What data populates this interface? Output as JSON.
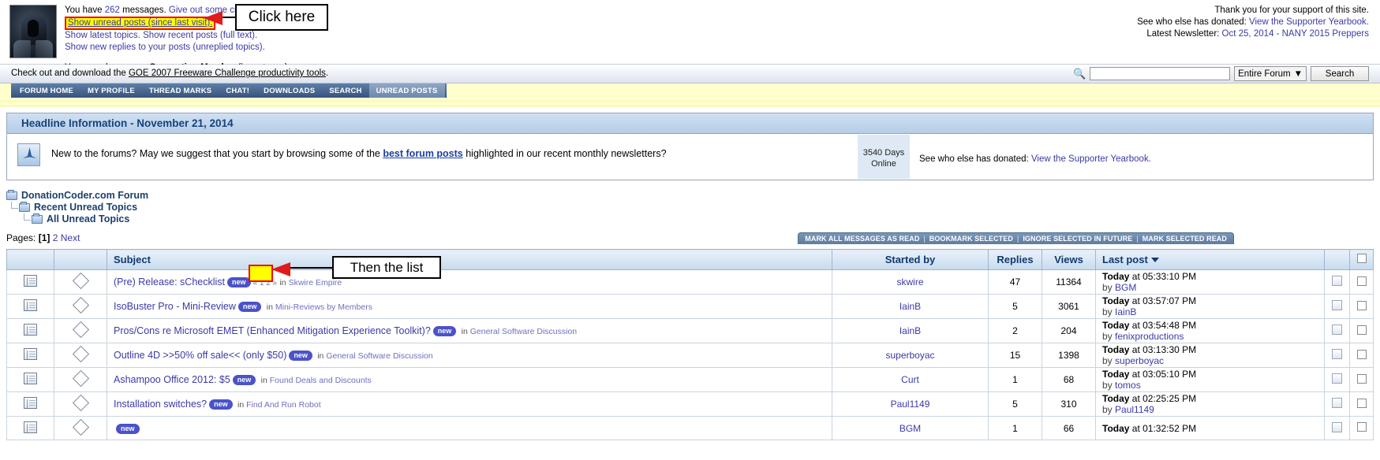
{
  "header": {
    "messages_prefix": "You have ",
    "messages_count": "262",
    "messages_suffix": " messages. ",
    "give_credit_link": "Give out some credit.",
    "unread_link": "Show unread posts (since last visit).",
    "latest_topics_link": "Show latest topics.",
    "recent_posts_link": "Show recent posts (full text).",
    "new_replies_link": "Show new replies to your posts (unreplied topics).",
    "membergroup_label": "Your member group: ",
    "membergroup_value": "Supporting Member",
    "logout_link": "logout now",
    "thanks_line": "Thank you for your support of this site.",
    "donated_label": "See who else has donated: ",
    "yearbook_link": "View the Supporter Yearbook.",
    "newsletter_label": "Latest Newsletter: ",
    "newsletter_link": "Oct 25, 2014 - NANY 2015 Preppers"
  },
  "announce": {
    "text_before": "Check out and download the ",
    "link": "GOE 2007 Freeware Challenge productivity tools",
    "text_after": "."
  },
  "search": {
    "icon": "magnifier-icon",
    "value": "",
    "placeholder": "",
    "scope": "Entire Forum",
    "scope_caret": "▼",
    "button": "Search"
  },
  "nav": {
    "tabs": [
      {
        "label": "FORUM HOME",
        "active": false
      },
      {
        "label": "MY PROFILE",
        "active": false
      },
      {
        "label": "THREAD MARKS",
        "active": false
      },
      {
        "label": "CHAT!",
        "active": false
      },
      {
        "label": "DOWNLOADS",
        "active": false
      },
      {
        "label": "SEARCH",
        "active": false
      },
      {
        "label": "UNREAD POSTS",
        "active": true
      }
    ]
  },
  "headline": {
    "title": "Headline Information - November 21, 2014",
    "icon": "anchor-icon",
    "text_before": "New to the forums? May we suggest that you start by browsing some of the ",
    "link": "best forum posts",
    "text_after": " highlighted in our recent monthly newsletters?",
    "days_online": "3540 Days\nOnline",
    "days_number": "3540 Days",
    "days_word": "Online",
    "donated_label": "See who else has donated: ",
    "yearbook_link": "View the Supporter Yearbook."
  },
  "tree": {
    "level1": "DonationCoder.com Forum",
    "level2": "Recent Unread Topics",
    "level3": "All Unread Topics"
  },
  "pages": {
    "label": "Pages: ",
    "current": "[1]",
    "page2": "2",
    "next": "Next"
  },
  "actions": {
    "items": [
      "MARK ALL MESSAGES AS READ",
      "BOOKMARK SELECTED",
      "IGNORE SELECTED IN FUTURE",
      "MARK SELECTED READ"
    ],
    "separator": "|"
  },
  "table": {
    "columns": {
      "icon1": "",
      "icon2": "",
      "subject": "Subject",
      "started_by": "Started by",
      "replies": "Replies",
      "views": "Views",
      "last_post": "Last post",
      "sort_caret": "▽",
      "action": "",
      "check": ""
    },
    "rows": [
      {
        "subject": "(Pre) Release: sChecklist",
        "badge": "new",
        "pages_mini": "« 1 2 »",
        "in_label": "in",
        "board": "Skwire Empire",
        "started_by": "skwire",
        "replies": "47",
        "views": "11364",
        "last_day": "Today",
        "last_time": " at 05:33:10 PM",
        "last_by_label": "by ",
        "last_by": "BGM"
      },
      {
        "subject": "IsoBuster Pro - Mini-Review",
        "badge": "new",
        "pages_mini": "",
        "in_label": "in",
        "board": "Mini-Reviews by Members",
        "started_by": "IainB",
        "replies": "5",
        "views": "3061",
        "last_day": "Today",
        "last_time": " at 03:57:07 PM",
        "last_by_label": "by ",
        "last_by": "IainB"
      },
      {
        "subject": "Pros/Cons re Microsoft EMET (Enhanced Mitigation Experience Toolkit)?",
        "badge": "new",
        "pages_mini": "",
        "in_label": "in",
        "board": "General Software Discussion",
        "started_by": "IainB",
        "replies": "2",
        "views": "204",
        "last_day": "Today",
        "last_time": " at 03:54:48 PM",
        "last_by_label": "by ",
        "last_by": "fenixproductions"
      },
      {
        "subject": "Outline 4D >>50% off sale<< (only $50)",
        "badge": "new",
        "pages_mini": "",
        "in_label": "in",
        "board": "General Software Discussion",
        "started_by": "superboyac",
        "replies": "15",
        "views": "1398",
        "last_day": "Today",
        "last_time": " at 03:13:30 PM",
        "last_by_label": "by ",
        "last_by": "superboyac"
      },
      {
        "subject": "Ashampoo Office 2012: $5",
        "badge": "new",
        "pages_mini": "",
        "in_label": "in",
        "board": "Found Deals and Discounts",
        "started_by": "Curt",
        "replies": "1",
        "views": "68",
        "last_day": "Today",
        "last_time": " at 03:05:10 PM",
        "last_by_label": "by ",
        "last_by": "tomos"
      },
      {
        "subject": "Installation switches?",
        "badge": "new",
        "pages_mini": "",
        "in_label": "in",
        "board": "Find And Run Robot",
        "started_by": "Paul1149",
        "replies": "5",
        "views": "310",
        "last_day": "Today",
        "last_time": " at 02:25:25 PM",
        "last_by_label": "by ",
        "last_by": "Paul1149"
      },
      {
        "subject": "",
        "badge": "new",
        "pages_mini": "",
        "in_label": "",
        "board": "",
        "started_by": "BGM",
        "replies": "1",
        "views": "66",
        "last_day": "Today",
        "last_time": " at 01:32:52 PM",
        "last_by_label": "",
        "last_by": ""
      }
    ]
  },
  "annotations": {
    "callout1": "Click here",
    "callout2": "Then the list",
    "highlight_color": "#ffff00",
    "highlight_border": "#ff0000",
    "arrow_color": "#e01b1b"
  }
}
